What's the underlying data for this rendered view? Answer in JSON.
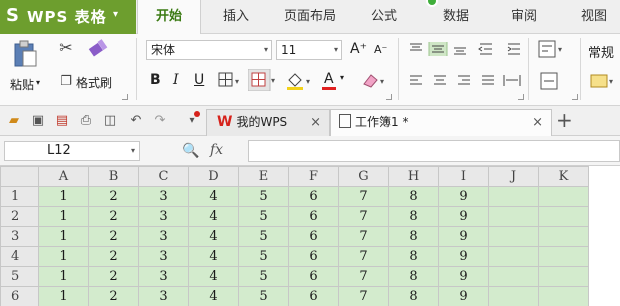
{
  "app": {
    "logo": "S",
    "name": "WPS 表格",
    "caret": "▾"
  },
  "menu_tabs": [
    "开始",
    "插入",
    "页面布局",
    "公式",
    "数据",
    "审阅",
    "视图"
  ],
  "ribbon": {
    "paste_label": "粘贴",
    "format_painter_label": "格式刷",
    "font_name": "宋体",
    "font_size": "11",
    "grow_font": "A⁺",
    "shrink_font": "A⁻",
    "bold": "B",
    "italic": "I",
    "underline": "U",
    "font_color_letter": "A",
    "number_format": "常规"
  },
  "doc_tabs": [
    {
      "label": "我的WPS",
      "close": "×"
    },
    {
      "label": "工作簿1 *",
      "close": "×"
    }
  ],
  "new_tab": "+",
  "formula_bar": {
    "cell_ref": "L12",
    "fx_label": "fx",
    "value": ""
  },
  "grid": {
    "columns": [
      "A",
      "B",
      "C",
      "D",
      "E",
      "F",
      "G",
      "H",
      "I",
      "J",
      "K"
    ],
    "rows": [
      {
        "header": "1",
        "cells": [
          "1",
          "2",
          "3",
          "4",
          "5",
          "6",
          "7",
          "8",
          "9",
          "",
          ""
        ]
      },
      {
        "header": "2",
        "cells": [
          "1",
          "2",
          "3",
          "4",
          "5",
          "6",
          "7",
          "8",
          "9",
          "",
          ""
        ]
      },
      {
        "header": "3",
        "cells": [
          "1",
          "2",
          "3",
          "4",
          "5",
          "6",
          "7",
          "8",
          "9",
          "",
          ""
        ]
      },
      {
        "header": "4",
        "cells": [
          "1",
          "2",
          "3",
          "4",
          "5",
          "6",
          "7",
          "8",
          "9",
          "",
          ""
        ]
      },
      {
        "header": "5",
        "cells": [
          "1",
          "2",
          "3",
          "4",
          "5",
          "6",
          "7",
          "8",
          "9",
          "",
          ""
        ]
      },
      {
        "header": "6",
        "cells": [
          "1",
          "2",
          "3",
          "4",
          "5",
          "6",
          "7",
          "8",
          "9",
          "",
          ""
        ]
      }
    ]
  },
  "colors": {
    "brand": "#6d9e2e",
    "active_tab_text": "#3a7a12",
    "cell_fill": "#d3ebcd",
    "wps_red": "#d6221b"
  }
}
